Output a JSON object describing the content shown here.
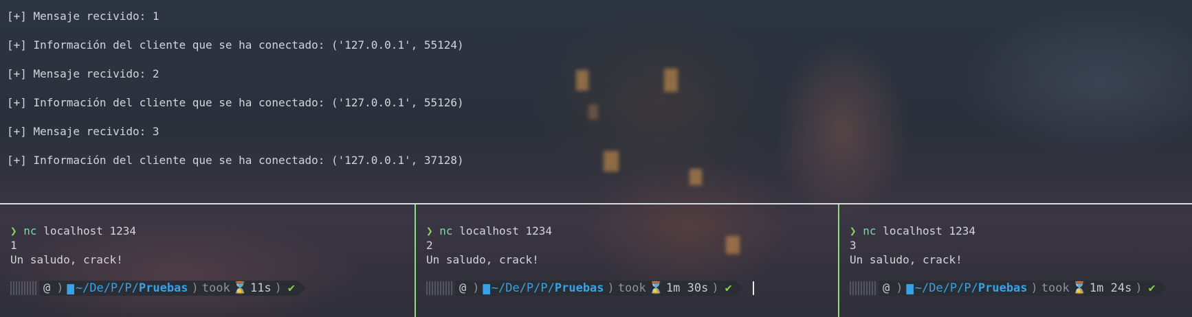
{
  "server_log": [
    "[+] Mensaje recivido: 1",
    "[+] Información del cliente que se ha conectado: ('127.0.0.1', 55124)",
    "[+] Mensaje recivido: 2",
    "[+] Información del cliente que se ha conectado: ('127.0.0.1', 55126)",
    "[+] Mensaje recivido: 3",
    "[+] Información del cliente que se ha conectado: ('127.0.0.1', 37128)"
  ],
  "prompt_symbol": "❯",
  "panes": [
    {
      "command": "nc",
      "args": " localhost 1234",
      "output": [
        "1",
        "Un saludo, crack!"
      ],
      "os_icon": "debian-icon",
      "path_prefix": "~/De/P/P/",
      "path_current": "Pruebas",
      "took_label": "took",
      "duration": "11s",
      "status": "✔",
      "active": false
    },
    {
      "command": "nc",
      "args": " localhost 1234",
      "output": [
        "2",
        "Un saludo, crack!"
      ],
      "os_icon": "debian-icon",
      "path_prefix": "~/De/P/P/",
      "path_current": "Pruebas",
      "took_label": "took",
      "duration": "1m 30s",
      "status": "✔",
      "active": true
    },
    {
      "command": "nc",
      "args": " localhost 1234",
      "output": [
        "3",
        "Un saludo, crack!"
      ],
      "os_icon": "debian-icon",
      "path_prefix": "~/De/P/P/",
      "path_current": "Pruebas",
      "took_label": "took",
      "duration": "1m 24s",
      "status": "✔",
      "active": false
    }
  ],
  "colors": {
    "active_border": "#8de07a",
    "prompt_arrow": "#8bd45a",
    "path": "#39a2e6",
    "status_ok": "#7fd34e"
  }
}
